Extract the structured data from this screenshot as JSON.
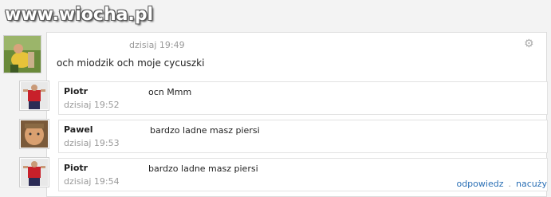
{
  "watermark": "www.wiocha.pl",
  "post": {
    "time": "dzisiaj 19:49",
    "text": "och miodzik och moje cycuszki"
  },
  "comments": [
    {
      "author": "Piotr",
      "time": "dzisiaj 19:52",
      "text": "осn Mmm"
    },
    {
      "author": "Pawel",
      "time": "dzisiaj 19:53",
      "text": "bardzo ladne masz piersi"
    },
    {
      "author": "Piotr",
      "time": "dzisiaj 19:54",
      "text": "bardzo ladne masz piersi"
    }
  ],
  "actions": {
    "reply": "odpowiedz",
    "dot": ".",
    "teach": "nacuży"
  },
  "icons": {
    "settings": "gear-icon"
  }
}
